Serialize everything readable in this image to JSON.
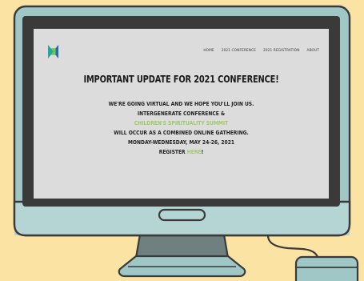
{
  "colors": {
    "background": "#fbe3a4",
    "monitor_frame": "#9ec7c6",
    "outline": "#3a3a3a",
    "screen": "#dcdcdc",
    "accent": "#a3c86a",
    "logo_teal": "#1fa7a0",
    "logo_green": "#7cc44a",
    "logo_blue": "#1f6eb4"
  },
  "icons": {
    "logo": "logo-icon",
    "power_button": "power-button-icon",
    "mouse": "mouse-icon"
  },
  "nav": {
    "items": [
      "HOME",
      "2021 CONFERENCE",
      "2021 REGISTRATION",
      "ABOUT"
    ]
  },
  "content": {
    "headline": "IMPORTANT UPDATE FOR 2021 CONFERENCE!",
    "line1": "WE'RE GOING VIRTUAL AND WE HOPE YOU'LL JOIN US.",
    "line2": "INTERGENERATE CONFERENCE &",
    "line3": "CHILDREN'S SPIRITUALITY SUMMIT",
    "line4": "WILL OCCUR AS A COMBINED ONLINE GATHERING.",
    "line5": "MONDAY-WEDNESDAY, MAY 24-26, 2021",
    "register_prefix": "REGISTER ",
    "register_link": "HERE",
    "register_suffix": "!"
  }
}
